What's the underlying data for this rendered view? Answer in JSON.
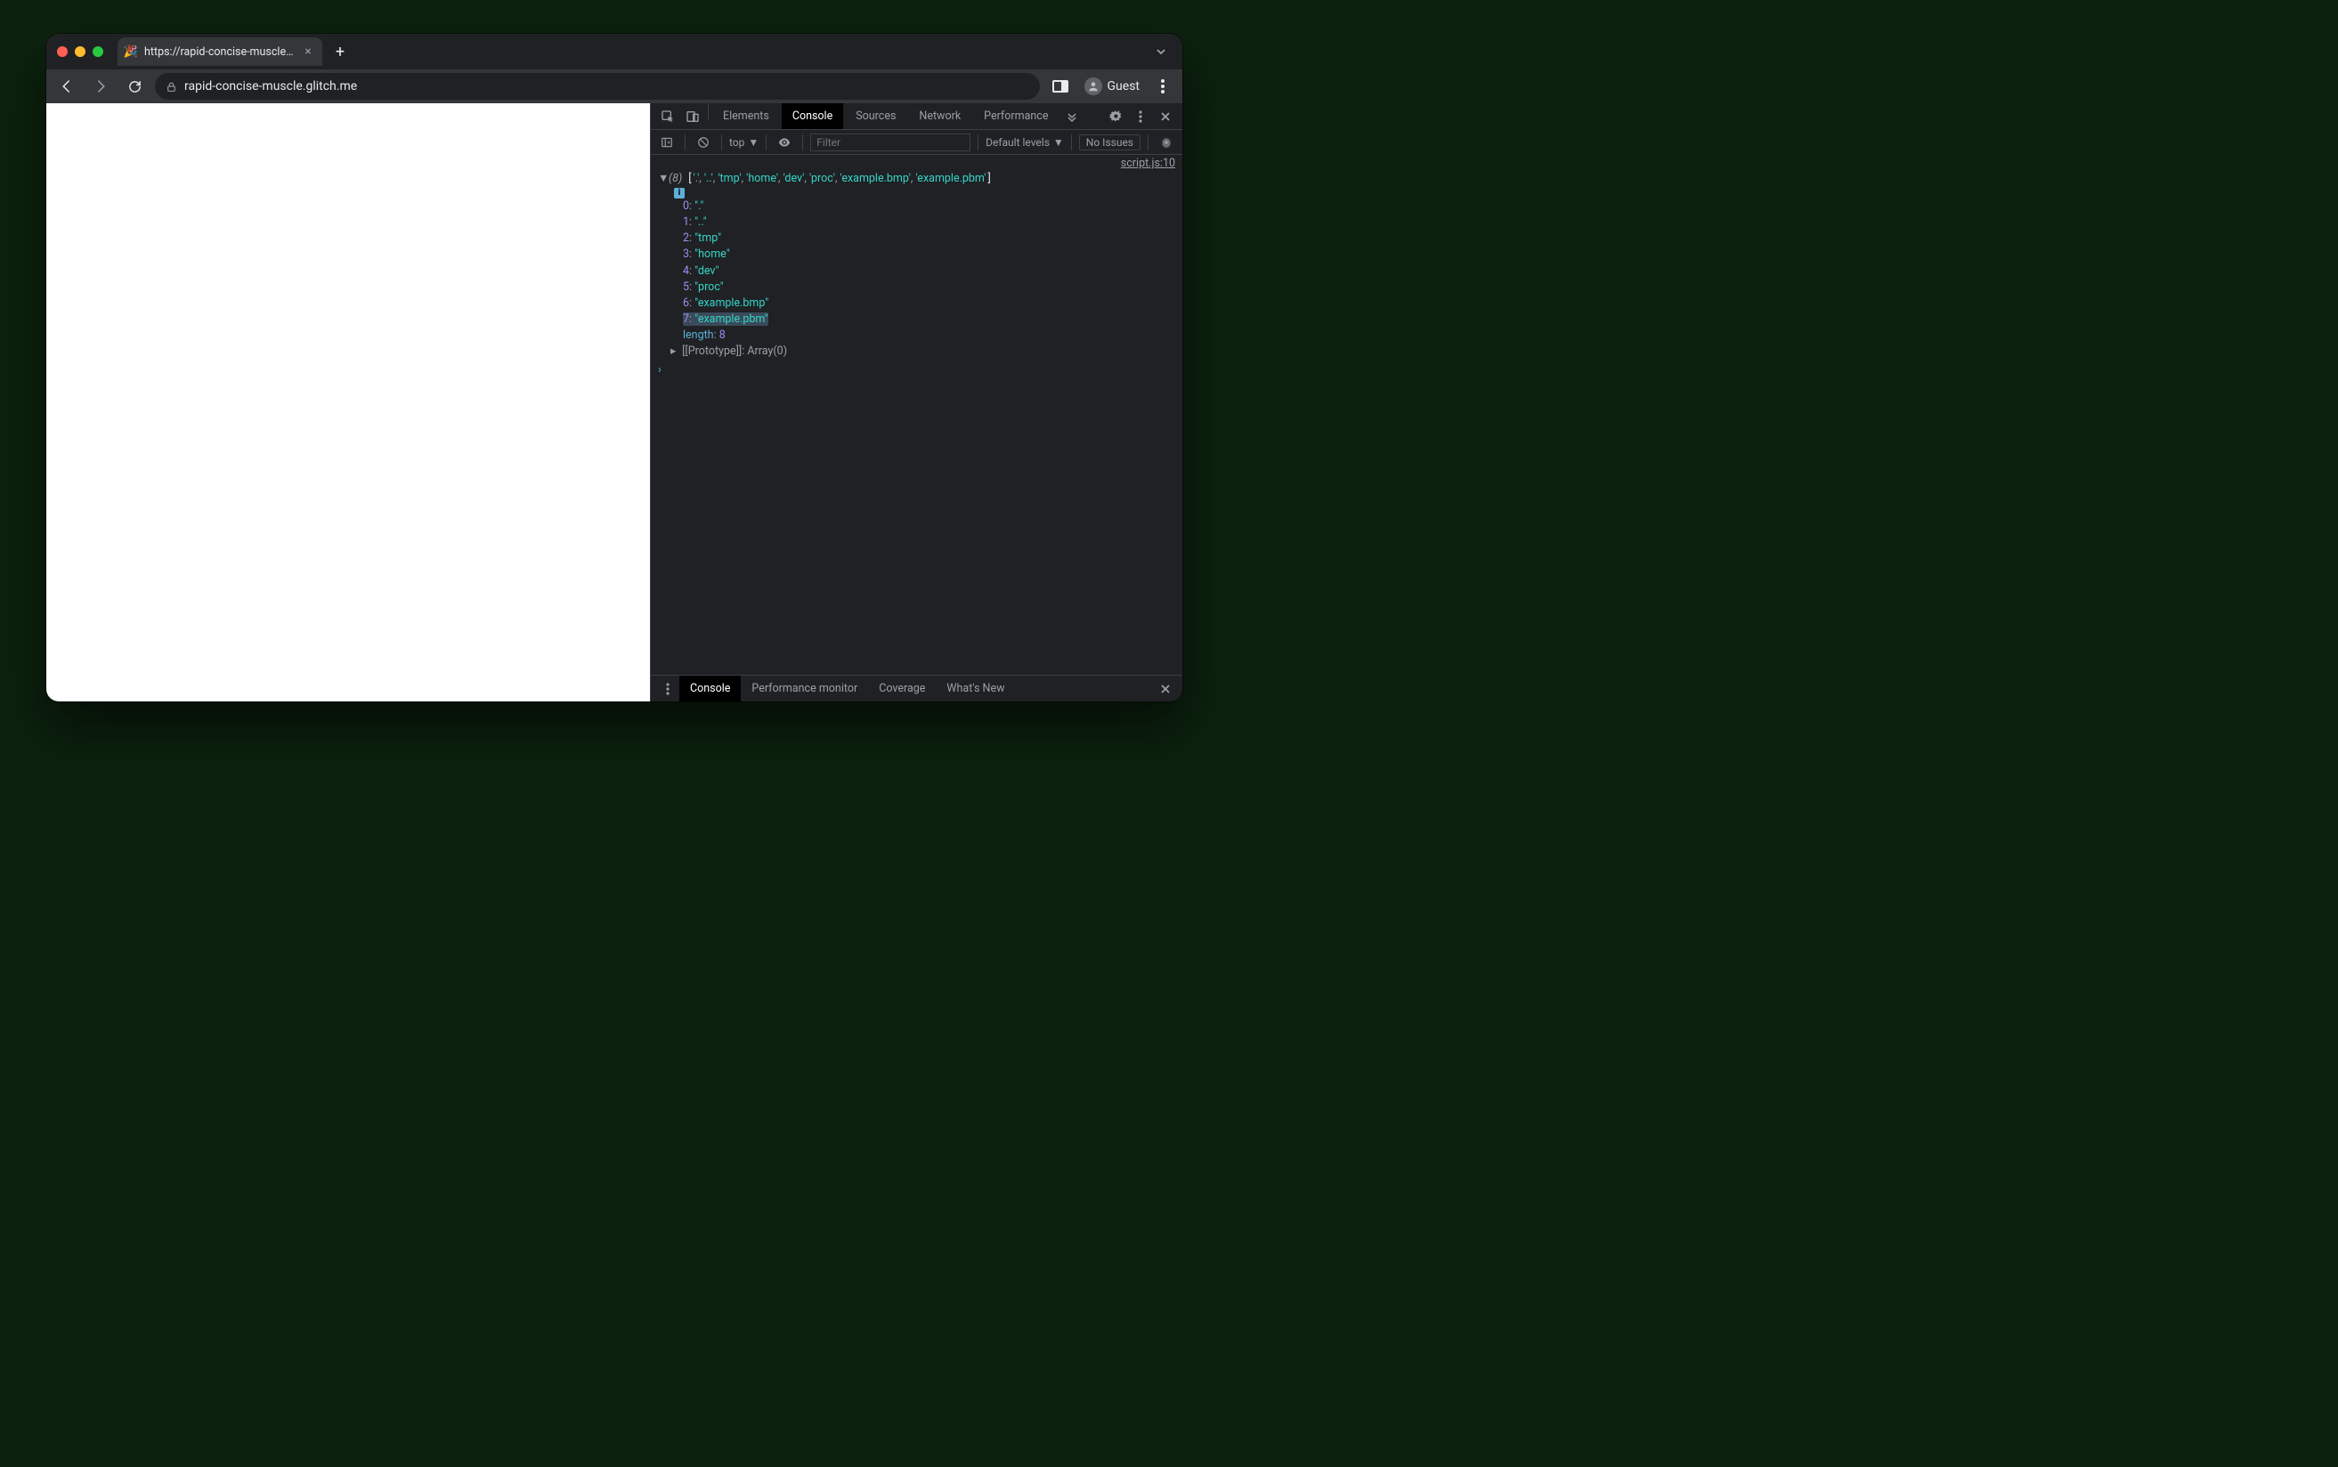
{
  "browser": {
    "tab_title": "https://rapid-concise-muscle.g",
    "tab_favicon": "🎉",
    "url_display": "rapid-concise-muscle.glitch.me",
    "guest_label": "Guest"
  },
  "devtools": {
    "tabs": [
      "Elements",
      "Console",
      "Sources",
      "Network",
      "Performance"
    ],
    "active_tab": "Console",
    "console_toolbar": {
      "context": "top",
      "filter_placeholder": "Filter",
      "levels": "Default levels",
      "issues": "No Issues"
    },
    "source_link": "script.js:10",
    "array_count": "(8)",
    "array_preview": [
      ".",
      "..",
      "tmp",
      "home",
      "dev",
      "proc",
      "example.bmp",
      "example.pbm"
    ],
    "array_entries": [
      {
        "index": "0",
        "value": "."
      },
      {
        "index": "1",
        "value": ".."
      },
      {
        "index": "2",
        "value": "tmp"
      },
      {
        "index": "3",
        "value": "home"
      },
      {
        "index": "4",
        "value": "dev"
      },
      {
        "index": "5",
        "value": "proc"
      },
      {
        "index": "6",
        "value": "example.bmp"
      },
      {
        "index": "7",
        "value": "example.pbm"
      }
    ],
    "highlighted_index": "7",
    "length_label": "length",
    "length_value": "8",
    "prototype_label": "[[Prototype]]",
    "prototype_value": "Array(0)",
    "drawer_tabs": [
      "Console",
      "Performance monitor",
      "Coverage",
      "What's New"
    ],
    "drawer_active": "Console"
  }
}
